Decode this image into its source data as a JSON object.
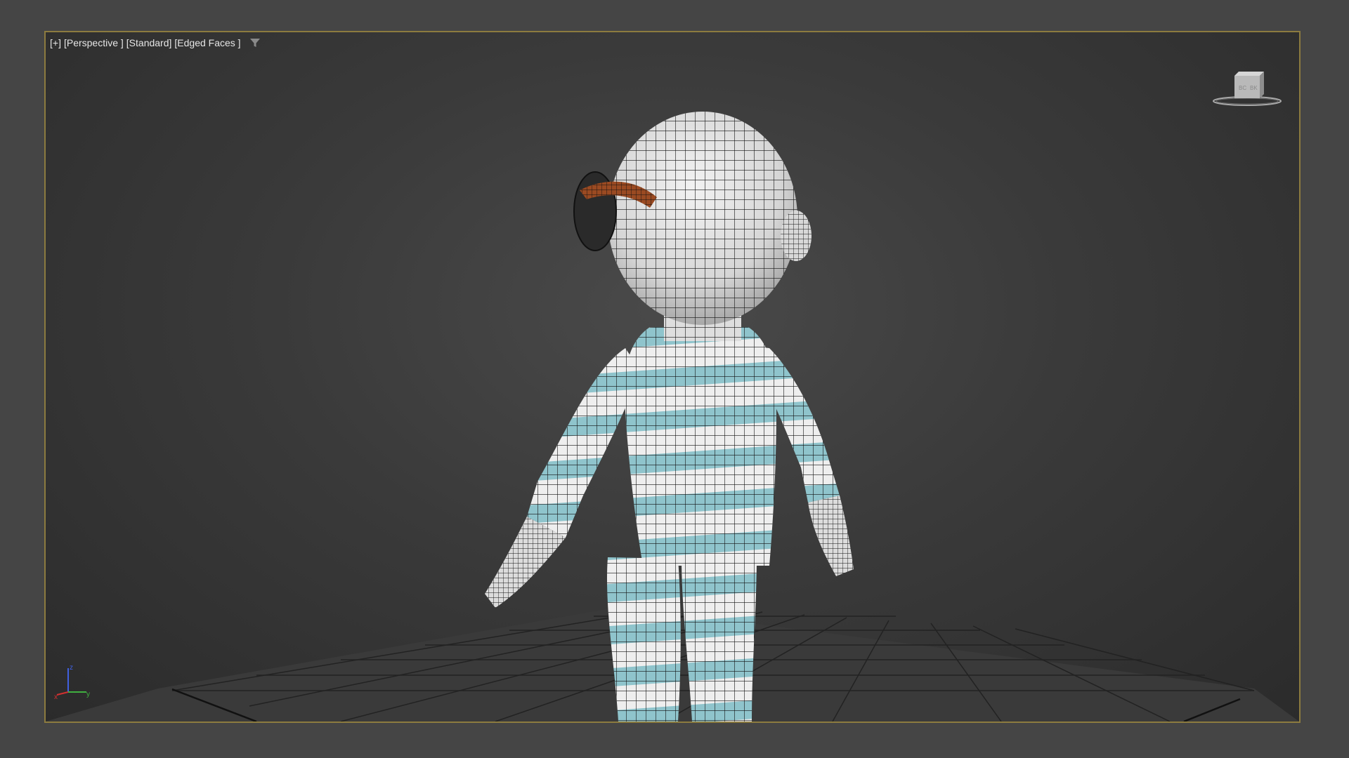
{
  "viewport": {
    "labels": [
      "[+]",
      "[Perspective ]",
      "[Standard]",
      "[Edged Faces ]"
    ],
    "filter_icon": "filter-icon",
    "border_color": "#8c7b3f",
    "background_color": "#3a3a3a"
  },
  "viewcube": {
    "icon": "viewcube-icon"
  },
  "axis_tripod": {
    "icon": "axis-tripod-icon",
    "axes": [
      "x",
      "y",
      "z"
    ],
    "colors": {
      "x": "#d23030",
      "y": "#40b040",
      "z": "#4060e0"
    }
  },
  "scene": {
    "grid_color": "#1e1e1e",
    "model": {
      "skin_color": "#e8e8e8",
      "stripe_color": "#8fc4cc",
      "hair_color": "#9a4a22",
      "wire_color": "#111111"
    }
  }
}
